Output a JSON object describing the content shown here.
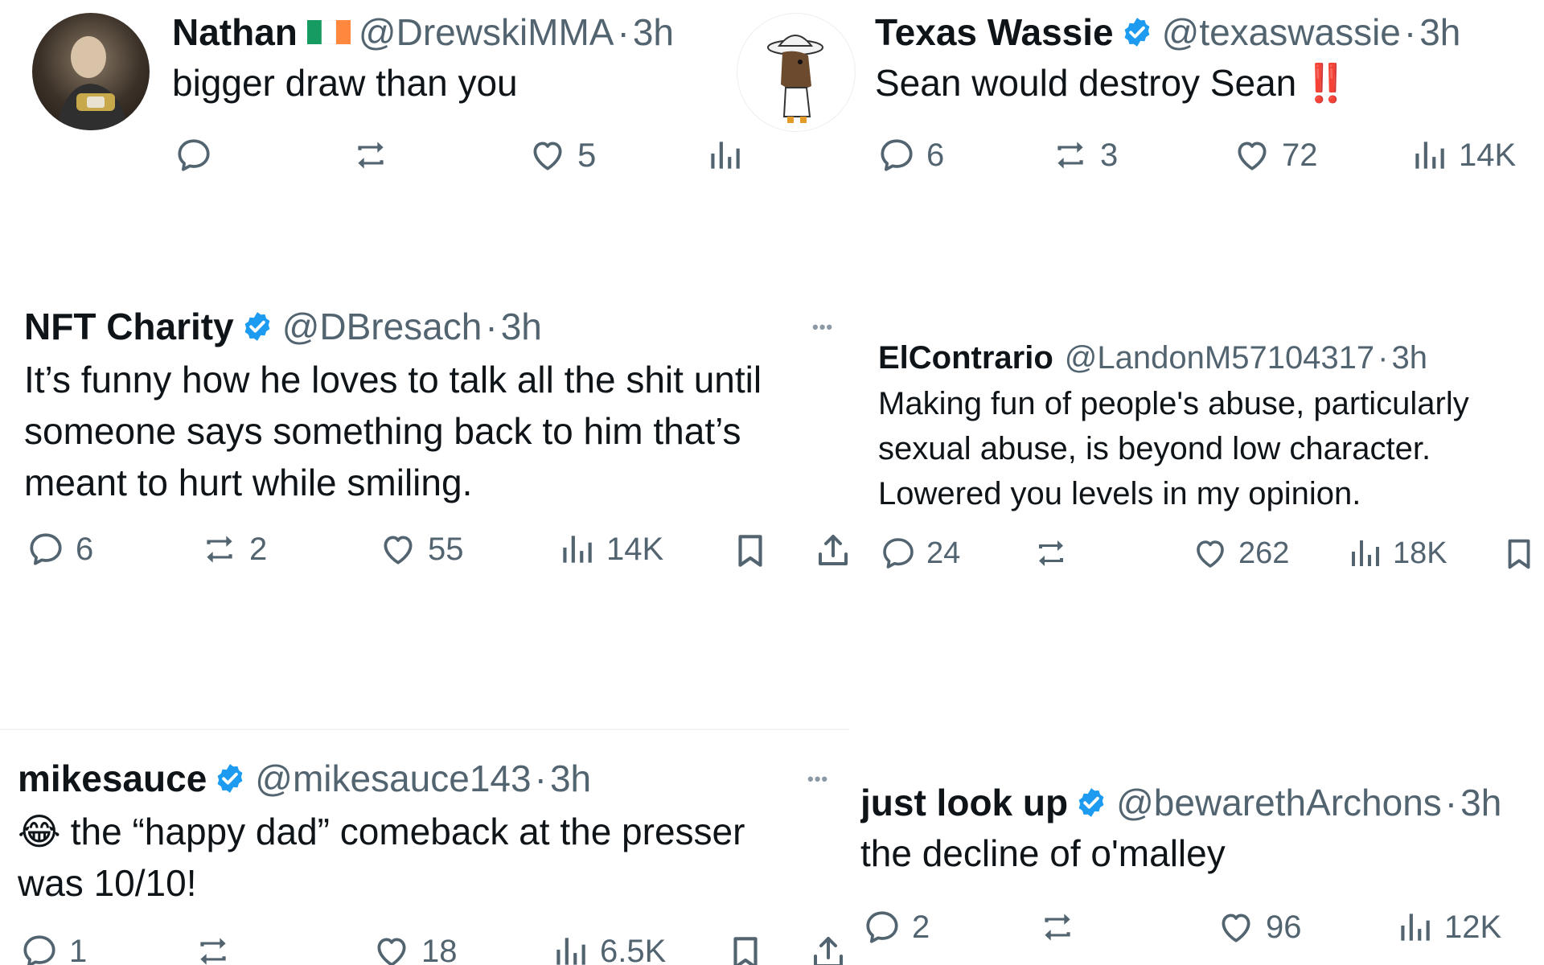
{
  "colors": {
    "text": "#0f1419",
    "muted": "#536471",
    "verified": "#1d9bf0",
    "divider": "#eff3f4"
  },
  "tweets": {
    "nathan": {
      "name": "Nathan",
      "flag": "ireland-flag-icon",
      "handle": "@DrewskiMMA",
      "sep": "·",
      "time": "3h",
      "text": "bigger draw than you",
      "counts": {
        "likes": "5"
      }
    },
    "texas": {
      "name": "Texas Wassie",
      "handle": "@texaswassie",
      "sep": "·",
      "time": "3h",
      "text": "Sean would destroy Sean",
      "text_emoji": "‼️",
      "counts": {
        "replies": "6",
        "reposts": "3",
        "likes": "72",
        "views": "14K"
      }
    },
    "nft": {
      "name": "NFT Charity",
      "handle": "@DBresach",
      "sep": "·",
      "time": "3h",
      "lines": [
        "It’s funny how he loves to talk all the shit until",
        "someone says something back to him that’s",
        "meant to hurt while smiling."
      ],
      "more": "•••",
      "counts": {
        "replies": "6",
        "reposts": "2",
        "likes": "55",
        "views": "14K"
      }
    },
    "elcontrario": {
      "name": "ElContrario",
      "handle": "@LandonM57104317",
      "sep": "·",
      "time": "3h",
      "lines": [
        "Making fun of people's abuse, particularly",
        "sexual abuse, is beyond low character.",
        "Lowered you levels in my opinion."
      ],
      "counts": {
        "replies": "24",
        "likes": "262",
        "views": "18K"
      }
    },
    "mikesauce": {
      "name": "mikesauce",
      "handle": "@mikesauce143",
      "sep": "·",
      "time": "3h",
      "emoji": "😂",
      "lines": [
        "the “happy dad” comeback at the presser",
        "was 10/10!"
      ],
      "more": "•••",
      "counts": {
        "replies": "1",
        "likes": "18",
        "views": "6.5K"
      }
    },
    "justlookup": {
      "name": "just look up",
      "handle": "@bewarethArchons",
      "sep": "·",
      "time": "3h",
      "text": "the decline of o'malley",
      "counts": {
        "replies": "2",
        "likes": "96",
        "views": "12K"
      }
    }
  }
}
